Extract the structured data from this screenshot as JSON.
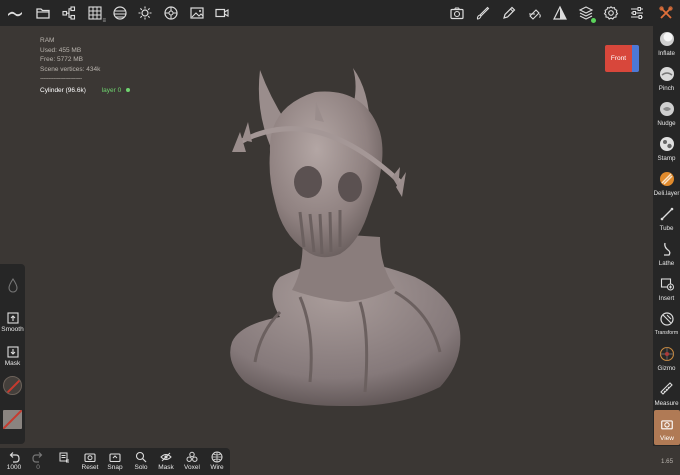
{
  "topbar": {
    "left_icons": [
      "nomad-logo-icon",
      "folder-icon",
      "scene-tree-icon",
      "grid-icon",
      "material-sphere-icon",
      "sun-icon",
      "environment-icon",
      "image-icon",
      "video-icon"
    ],
    "right_icons": [
      "camera-icon",
      "brush-icon",
      "pen-icon",
      "paint-icon",
      "shading-icon",
      "layers-icon",
      "settings-icon",
      "sliders-icon",
      "tools-toggle-icon"
    ]
  },
  "stats": {
    "ram": "RAM",
    "used": "Used: 455 MB",
    "free": "Free: 5772 MB",
    "vertices": "Scene vertices: 434k",
    "separator": "-------------------------",
    "object": "Cylinder (96.6k)",
    "layer": "layer 0"
  },
  "viewcube": {
    "face": "Front"
  },
  "tools": [
    {
      "label": "Inflate",
      "icon": "inflate-icon"
    },
    {
      "label": "Pinch",
      "icon": "pinch-icon"
    },
    {
      "label": "Nudge",
      "icon": "nudge-icon"
    },
    {
      "label": "Stamp",
      "icon": "stamp-icon"
    },
    {
      "label": "Deli.layer",
      "icon": "delete-layer-icon"
    },
    {
      "label": "Tube",
      "icon": "tube-icon"
    },
    {
      "label": "Lathe",
      "icon": "lathe-icon"
    },
    {
      "label": "Insert",
      "icon": "insert-icon"
    },
    {
      "label": "Transform",
      "icon": "transform-icon"
    },
    {
      "label": "Gizmo",
      "icon": "gizmo-icon"
    },
    {
      "label": "Measure",
      "icon": "measure-icon"
    }
  ],
  "view_tool": {
    "label": "View",
    "icon": "view-camera-icon"
  },
  "fps": "1.65",
  "left_panel": {
    "smooth_label": "Smooth",
    "mask_label": "Mask"
  },
  "bottombar": {
    "undo_count": "1000",
    "redo_count": "0",
    "items": [
      {
        "label": "Reset",
        "icon": "reset-icon"
      },
      {
        "label": "Snap",
        "icon": "snap-icon"
      },
      {
        "label": "Solo",
        "icon": "solo-icon"
      },
      {
        "label": "Mask",
        "icon": "mask-visibility-icon"
      },
      {
        "label": "Voxel",
        "icon": "voxel-icon"
      },
      {
        "label": "Wire",
        "icon": "wireframe-icon"
      }
    ]
  },
  "colors": {
    "viewport_bg": "#3b3734",
    "panel_bg": "#262626",
    "accent_view": "#b07a55",
    "layer_green": "#6fd36f"
  }
}
